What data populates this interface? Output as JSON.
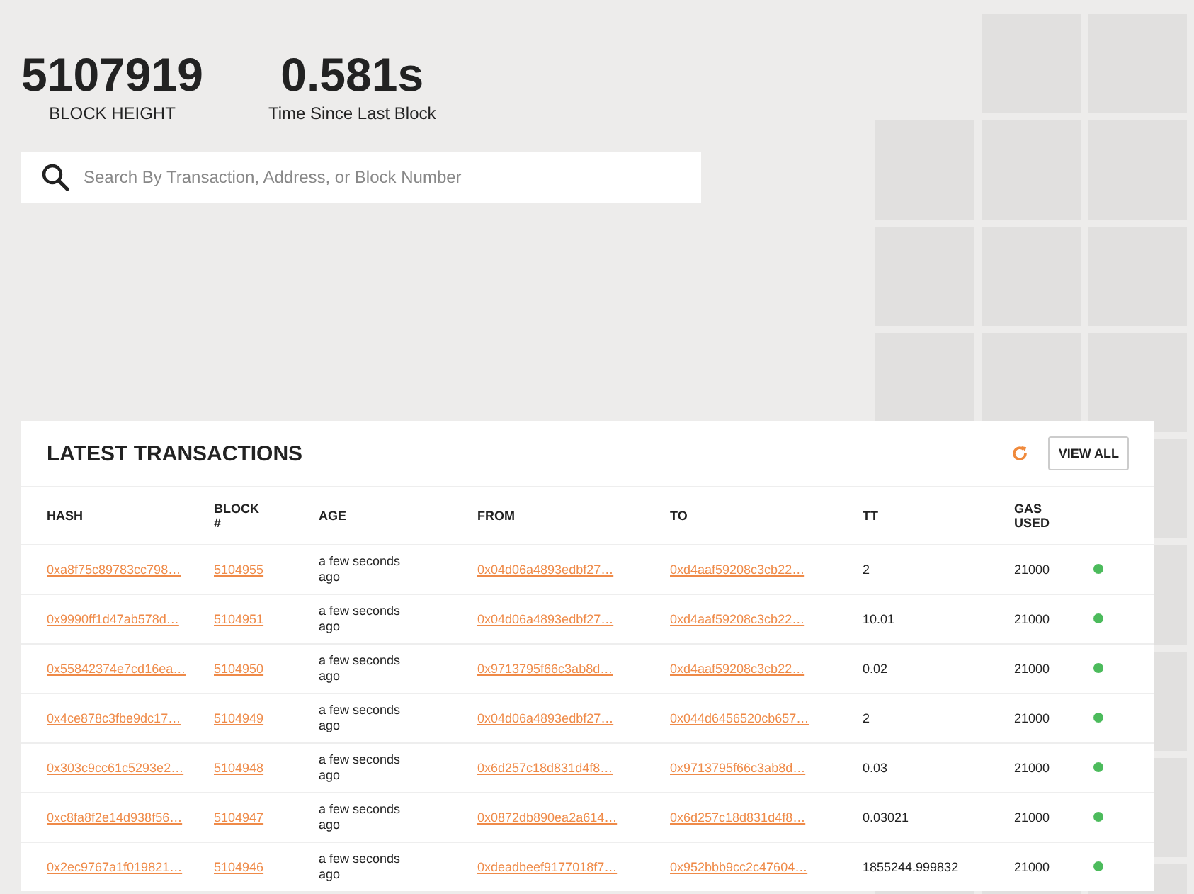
{
  "stats": [
    {
      "value": "5107919",
      "label": "BLOCK HEIGHT"
    },
    {
      "value": "0.581s",
      "label": "Time Since Last Block"
    }
  ],
  "search": {
    "placeholder": "Search By Transaction, Address, or Block Number"
  },
  "transactions": {
    "title": "LATEST TRANSACTIONS",
    "view_all": "VIEW ALL",
    "columns": [
      "HASH",
      "BLOCK #",
      "AGE",
      "FROM",
      "TO",
      "TT",
      "GAS USED"
    ],
    "rows": [
      {
        "hash": "0xa8f75c89783cc798…",
        "block": "5104955",
        "age": "a few seconds ago",
        "from": "0x04d06a4893edbf27…",
        "to": "0xd4aaf59208c3cb22…",
        "tt": "2",
        "gas": "21000",
        "color": "#4cbb5c"
      },
      {
        "hash": "0x9990ff1d47ab578d…",
        "block": "5104951",
        "age": "a few seconds ago",
        "from": "0x04d06a4893edbf27…",
        "to": "0xd4aaf59208c3cb22…",
        "tt": "10.01",
        "gas": "21000",
        "color": "#4cbb5c"
      },
      {
        "hash": "0x55842374e7cd16ea…",
        "block": "5104950",
        "age": "a few seconds ago",
        "from": "0x9713795f66c3ab8d…",
        "to": "0xd4aaf59208c3cb22…",
        "tt": "0.02",
        "gas": "21000",
        "color": "#4cbb5c"
      },
      {
        "hash": "0x4ce878c3fbe9dc17…",
        "block": "5104949",
        "age": "a few seconds ago",
        "from": "0x04d06a4893edbf27…",
        "to": "0x044d6456520cb657…",
        "tt": "2",
        "gas": "21000",
        "color": "#4cbb5c"
      },
      {
        "hash": "0x303c9cc61c5293e2…",
        "block": "5104948",
        "age": "a few seconds ago",
        "from": "0x6d257c18d831d4f8…",
        "to": "0x9713795f66c3ab8d…",
        "tt": "0.03",
        "gas": "21000",
        "color": "#4cbb5c"
      },
      {
        "hash": "0xc8fa8f2e14d938f56…",
        "block": "5104947",
        "age": "a few seconds ago",
        "from": "0x0872db890ea2a614…",
        "to": "0x6d257c18d831d4f8…",
        "tt": "0.03021",
        "gas": "21000",
        "color": "#4cbb5c"
      },
      {
        "hash": "0x2ec9767a1f019821…",
        "block": "5104946",
        "age": "a few seconds ago",
        "from": "0xdeadbeef9177018f7…",
        "to": "0x952bbb9cc2c47604…",
        "tt": "1855244.999832",
        "gas": "21000",
        "color": "#4cbb5c"
      }
    ]
  }
}
